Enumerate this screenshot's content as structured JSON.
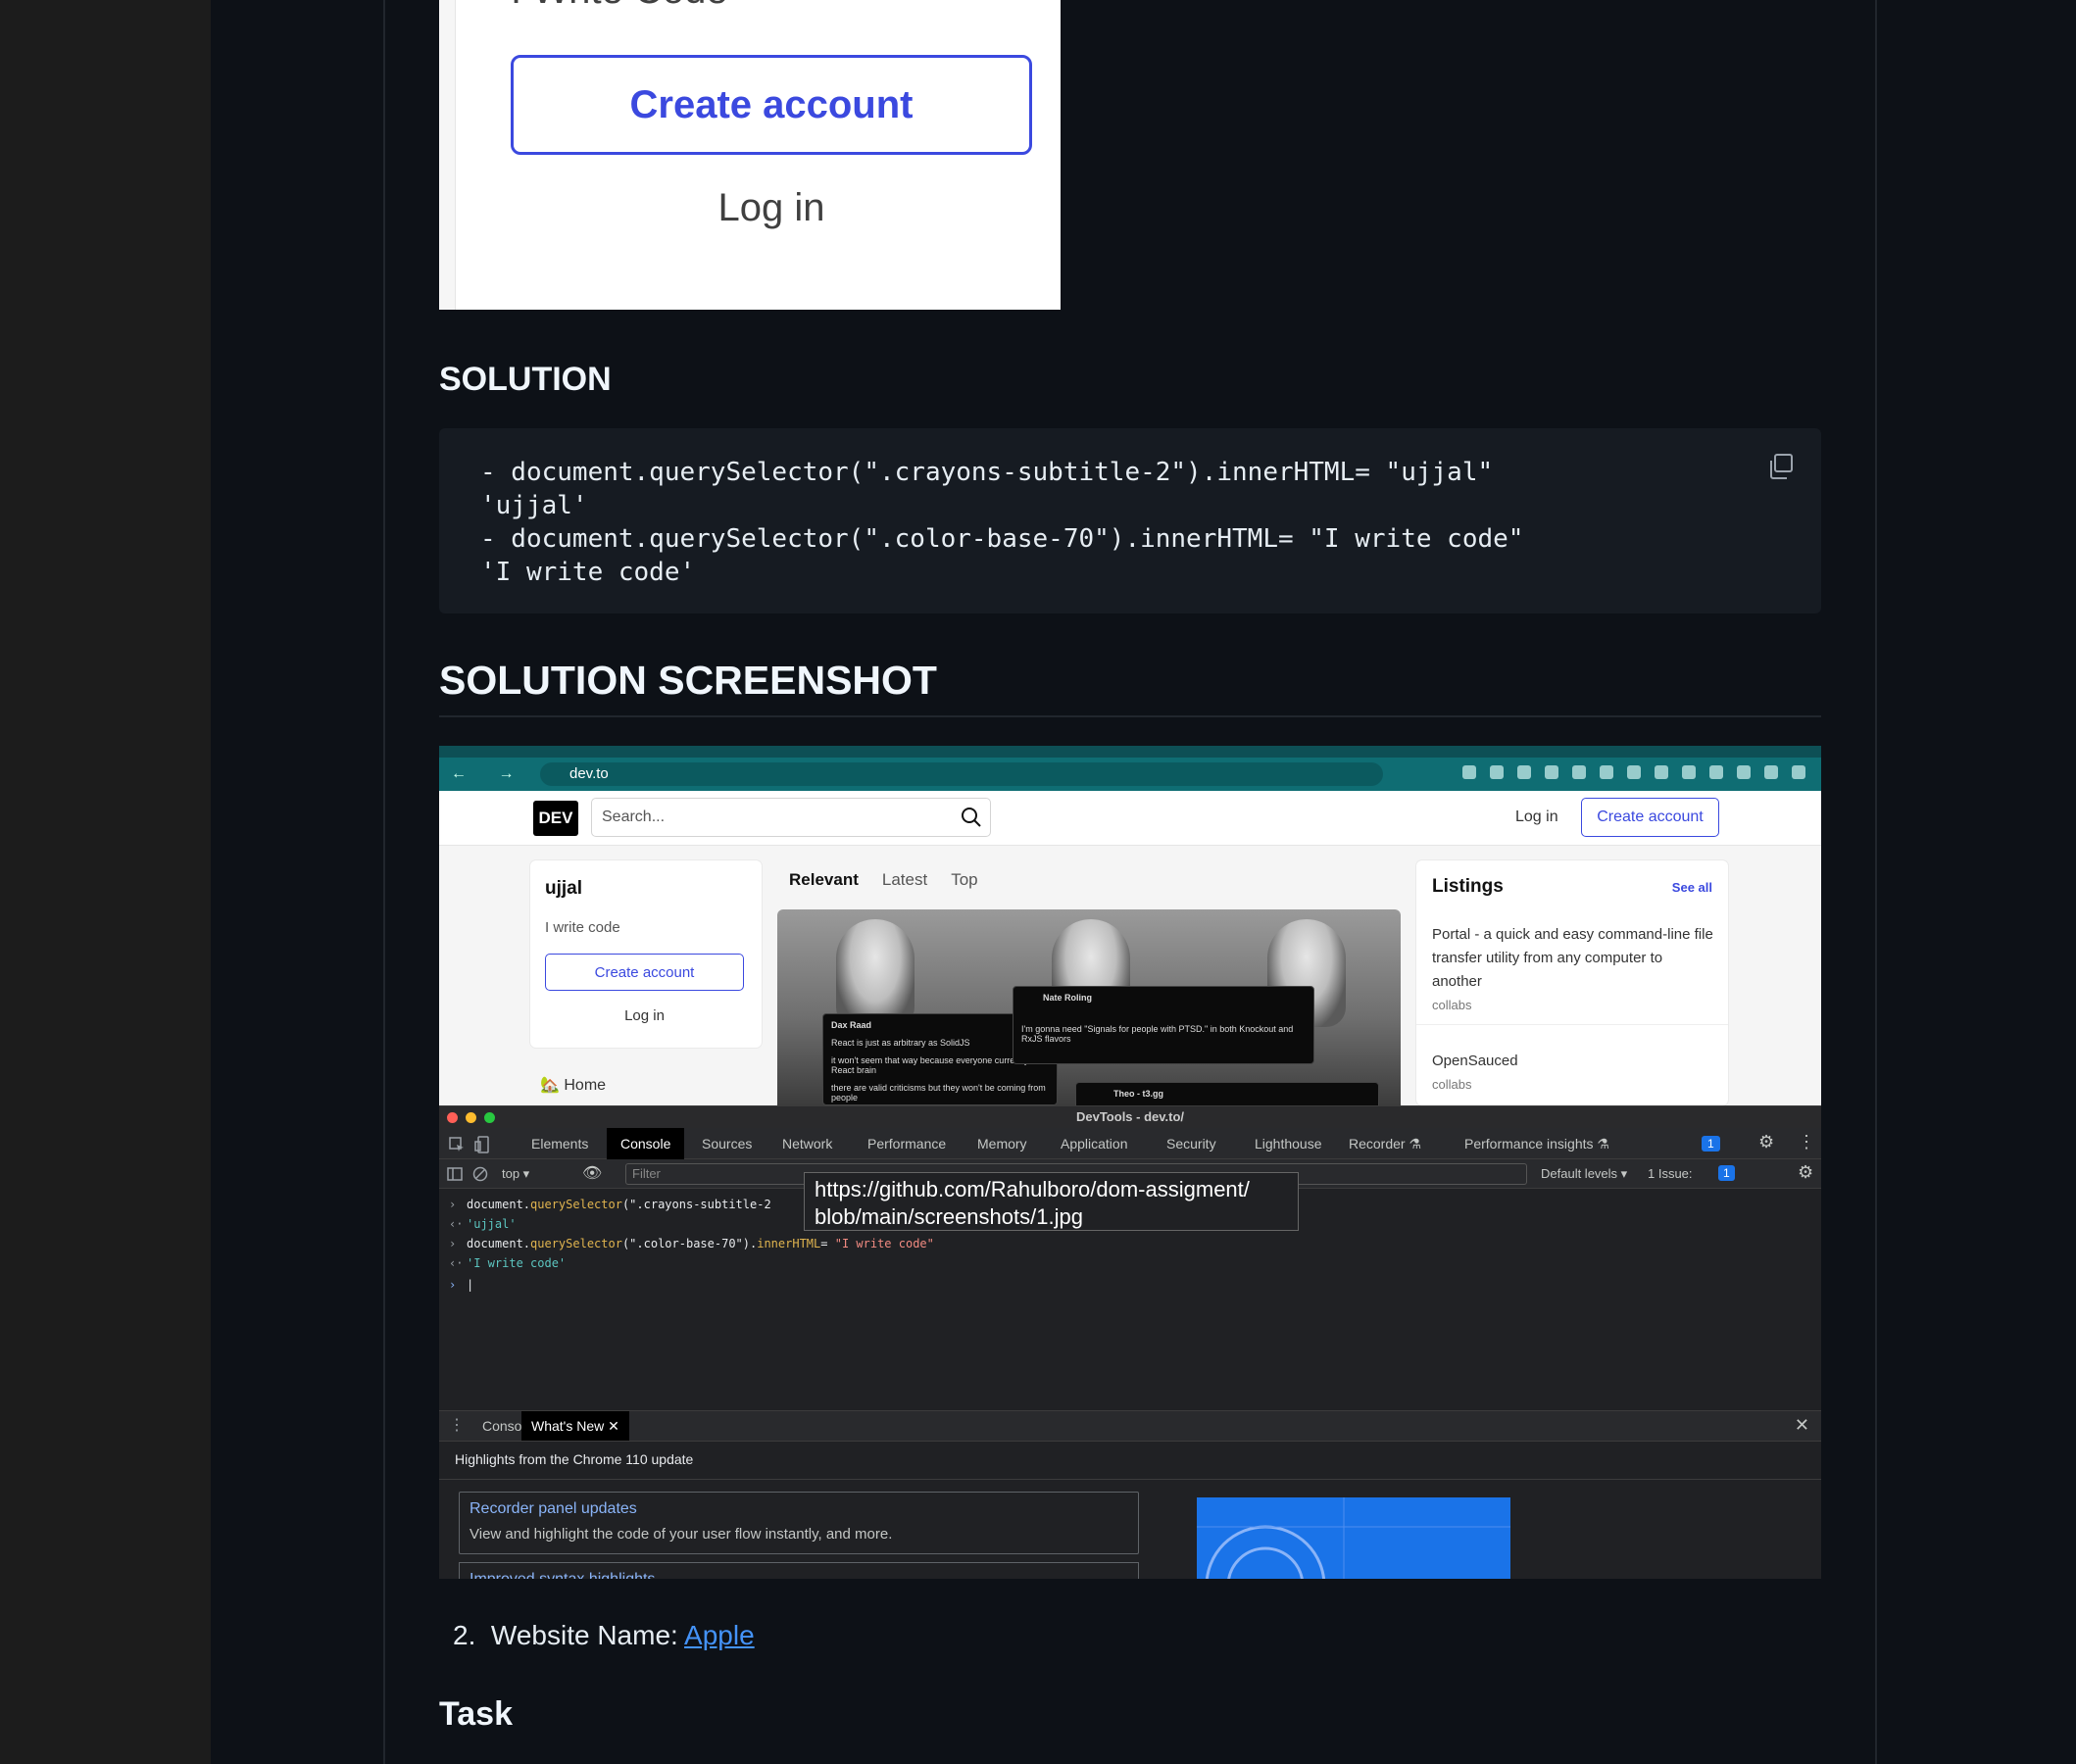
{
  "crop_shot": {
    "cropped_text": "I Write Code",
    "create_account": "Create account",
    "log_in": "Log in"
  },
  "solution": {
    "heading": "SOLUTION",
    "code": "- document.querySelector(\".crayons-subtitle-2\").innerHTML= \"ujjal\"\n'ujjal'\n- document.querySelector(\".color-base-70\").innerHTML= \"I write code\"\n'I write code'"
  },
  "screenshot_heading": "SOLUTION SCREENSHOT",
  "browser": {
    "url": "dev.to",
    "nav_icons": "← → ⟳",
    "site": {
      "logo": "DEV",
      "search_placeholder": "Search...",
      "log_in": "Log in",
      "create_account": "Create account",
      "side_card": {
        "name": "ujjal",
        "subtitle": "I write code",
        "create_account": "Create account",
        "log_in": "Log in"
      },
      "home": "🏡  Home",
      "feed_tabs": [
        "Relevant",
        "Latest",
        "Top"
      ],
      "tweets": {
        "t1_name": "Dax Raad",
        "t1_text": "React is just as arbitrary as SolidJS",
        "t1_text2": "it won't seem that way because everyone currently has React brain",
        "t1_text3": "there are valid criticisms but they won't be coming from people",
        "t2_name": "Nate Roling",
        "t2_text": "I'm gonna need \"Signals for people with PTSD.\" in both Knockout and RxJS flavors",
        "t3_name": "Theo - t3.gg"
      },
      "listings": {
        "heading": "Listings",
        "see_all": "See all",
        "item1": "Portal - a quick and easy command-line file transfer utility from any computer to another",
        "item1_tag": "collabs",
        "item2": "OpenSauced",
        "item2_tag": "collabs"
      }
    },
    "devtools": {
      "title": "DevTools - dev.to/",
      "tabs": [
        "Elements",
        "Console",
        "Sources",
        "Network",
        "Performance",
        "Memory",
        "Application",
        "Security",
        "Lighthouse",
        "Recorder ⚗",
        "Performance insights ⚗"
      ],
      "issues_badge": "1",
      "context": "top ▾",
      "filter_placeholder": "Filter",
      "default_levels": "Default levels ▾",
      "issue_count": "1 Issue:",
      "issue_num": "1",
      "console": {
        "l1_prefix": "document.",
        "l1_fn": "querySelector",
        "l1_arg": "(\".crayons-subtitle-2",
        "l2": "'ujjal'",
        "l3_prefix": "document.",
        "l3_fn": "querySelector",
        "l3_mid": "(\".color-base-70\").",
        "l3_prop": "innerHTML",
        "l3_eq": "= ",
        "l3_val": "\"I write code\"",
        "l4": "'I write code'"
      },
      "drawer_tabs": [
        "Console",
        "What's New ✕"
      ],
      "highlights": "Highlights from the Chrome 110 update",
      "card1_title": "Recorder panel updates",
      "card1_desc": "View and highlight the code of your user flow instantly, and more.",
      "card2_title": "Improved syntax highlights"
    },
    "tooltip": "https://github.com/Rahulboro/dom-assigment/\nblob/main/screenshots/1.jpg"
  },
  "list_item": {
    "number": "2.",
    "label": "Website Name: ",
    "link": "Apple"
  },
  "task_heading": "Task",
  "colors": {
    "page_bg": "#0d1117",
    "accent": "#3b49df",
    "link": "#4493f8"
  }
}
